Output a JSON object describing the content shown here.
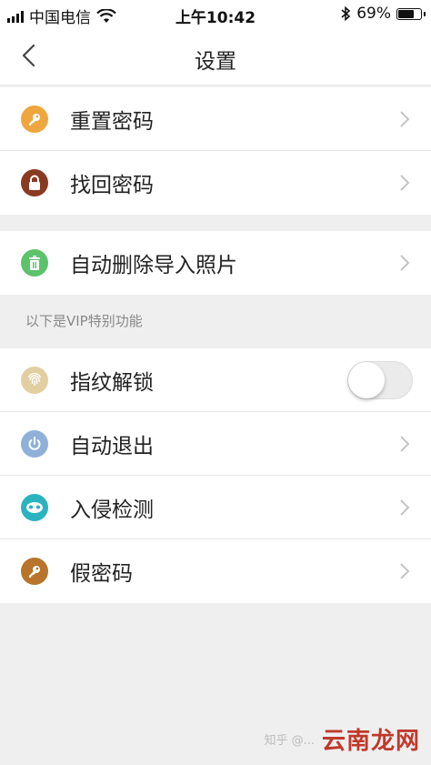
{
  "status": {
    "carrier": "中国电信",
    "time": "上午10:42",
    "battery": "69%",
    "battery_level": 0.69
  },
  "nav": {
    "title": "设置"
  },
  "group1": [
    {
      "label": "重置密码",
      "icon": "key-icon",
      "color": "#f0a63e"
    },
    {
      "label": "找回密码",
      "icon": "lock-icon",
      "color": "#8a3a22"
    }
  ],
  "group2": [
    {
      "label": "自动删除导入照片",
      "icon": "trash-icon",
      "color": "#5cc26b"
    }
  ],
  "vip_hint": "以下是VIP特别功能",
  "group3": [
    {
      "label": "指纹解锁",
      "icon": "fingerprint-icon",
      "color": "#e2cfa1",
      "toggle": false
    },
    {
      "label": "自动退出",
      "icon": "power-icon",
      "color": "#8fb0d8"
    },
    {
      "label": "入侵检测",
      "icon": "mask-icon",
      "color": "#2bb3c0"
    },
    {
      "label": "假密码",
      "icon": "key-icon",
      "color": "#b8742a"
    }
  ],
  "watermark": {
    "small": "知乎 @...",
    "big": "云南龙网"
  }
}
